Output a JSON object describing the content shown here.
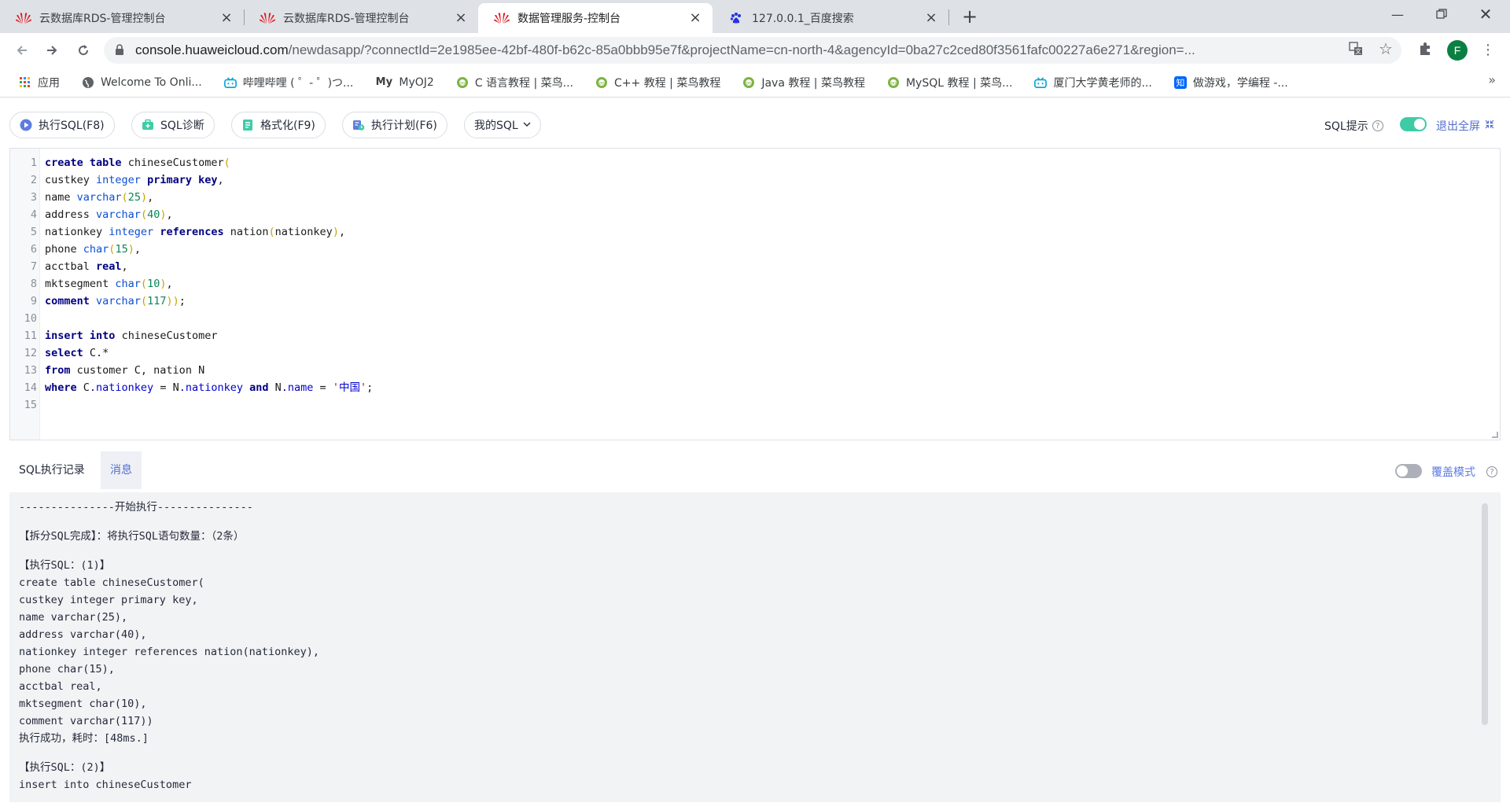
{
  "browser": {
    "tabs": [
      {
        "title": "云数据库RDS-管理控制台",
        "icon": "huawei-logo"
      },
      {
        "title": "云数据库RDS-管理控制台",
        "icon": "huawei-logo"
      },
      {
        "title": "数据管理服务-控制台",
        "icon": "huawei-logo",
        "active": true
      },
      {
        "title": "127.0.0.1_百度搜索",
        "icon": "baidu-paw"
      }
    ],
    "url_host": "console.huaweicloud.com",
    "url_rest": "/newdasapp/?connectId=2e1985ee-42bf-480f-b62c-85a0bbb95e7f&projectName=cn-north-4&agencyId=0ba27c2ced80f3561fafc00227a6e271&region=...",
    "profile_initial": "F",
    "bookmarks": [
      {
        "label": "应用",
        "icon": "apps-grid-icon"
      },
      {
        "label": "Welcome To Onli...",
        "icon": "globe-icon"
      },
      {
        "label": "哔哩哔哩 ( ゜- ゜)つ...",
        "icon": "bilibili-icon"
      },
      {
        "label": "MyOJ2",
        "icon": "myoj-icon"
      },
      {
        "label": "C 语言教程 | 菜鸟...",
        "icon": "runoob-icon"
      },
      {
        "label": "C++ 教程 | 菜鸟教程",
        "icon": "runoob-icon"
      },
      {
        "label": "Java 教程 | 菜鸟教程",
        "icon": "runoob-icon"
      },
      {
        "label": "MySQL 教程 | 菜鸟...",
        "icon": "runoob-icon"
      },
      {
        "label": "厦门大学黄老师的...",
        "icon": "bilibili-icon"
      },
      {
        "label": "做游戏，学编程 -...",
        "icon": "zhihu-icon"
      }
    ]
  },
  "toolbar": {
    "execute": "执行SQL(F8)",
    "diagnose": "SQL诊断",
    "format": "格式化(F9)",
    "plan": "执行计划(F6)",
    "my_sql": "我的SQL",
    "sql_hint": "SQL提示",
    "exit_fullscreen": "退出全屏",
    "colors": {
      "accent": "#526ecc",
      "toggle_on": "#3dcca6"
    }
  },
  "editor": {
    "lines": [
      "create table chineseCustomer(",
      "custkey integer primary key,",
      "name varchar(25),",
      "address varchar(40),",
      "nationkey integer references nation(nationkey),",
      "phone char(15),",
      "acctbal real,",
      "mktsegment char(10),",
      "comment varchar(117));",
      "",
      "insert into chineseCustomer",
      "select C.*",
      "from customer C, nation N",
      "where C.nationkey = N.nationkey and N.name = '中国';",
      ""
    ]
  },
  "results": {
    "tab_history": "SQL执行记录",
    "tab_messages": "消息",
    "cover_mode": "覆盖模式",
    "messages": [
      "---------------开始执行---------------",
      "",
      "【拆分SQL完成】：将执行SQL语句数量：（2条）",
      "",
      "【执行SQL：(1)】",
      "create table chineseCustomer(",
      "custkey integer primary key,",
      "name varchar(25),",
      "address varchar(40),",
      "nationkey integer references nation(nationkey),",
      "phone char(15),",
      "acctbal real,",
      "mktsegment char(10),",
      "comment varchar(117))",
      "执行成功，耗时：[48ms.]",
      "",
      "【执行SQL：(2)】",
      "insert into chineseCustomer"
    ]
  }
}
